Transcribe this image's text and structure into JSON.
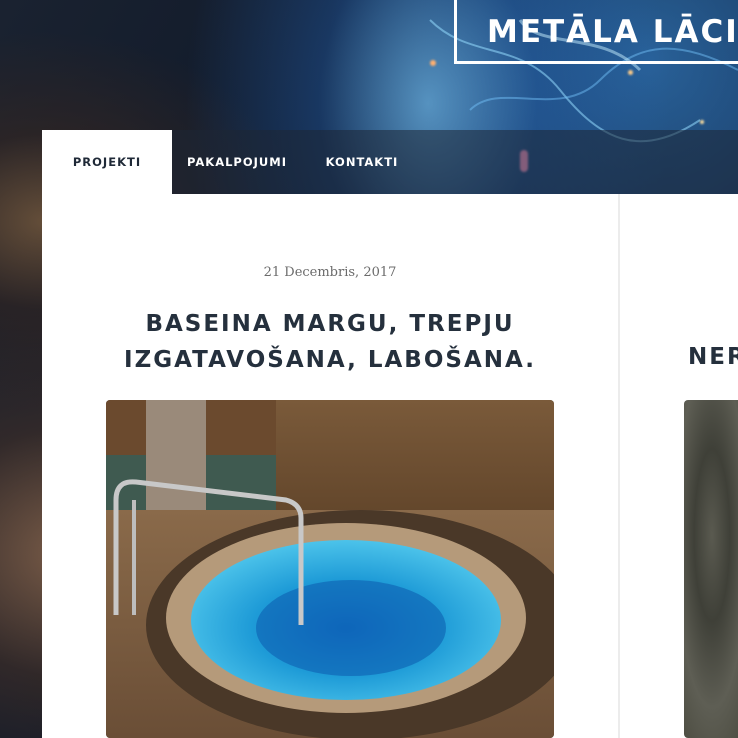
{
  "site": {
    "logo_text": "METĀLA LĀCIS"
  },
  "nav": {
    "items": [
      {
        "label": "PROJEKTI",
        "active": true
      },
      {
        "label": "PAKALPOJUMI",
        "active": false
      },
      {
        "label": "KONTAKTI",
        "active": false
      }
    ]
  },
  "posts": [
    {
      "date": "21 Decembris, 2017",
      "title_line1": "BASEINA MARGU, TREPJU",
      "title_line2": "IZGATAVOŠANA, LABOŠANA."
    },
    {
      "title_partial": "NER"
    }
  ],
  "colors": {
    "accent_text": "#25303d",
    "nav_active_bg": "#ffffff",
    "pool_water": "#1e9bd7"
  }
}
